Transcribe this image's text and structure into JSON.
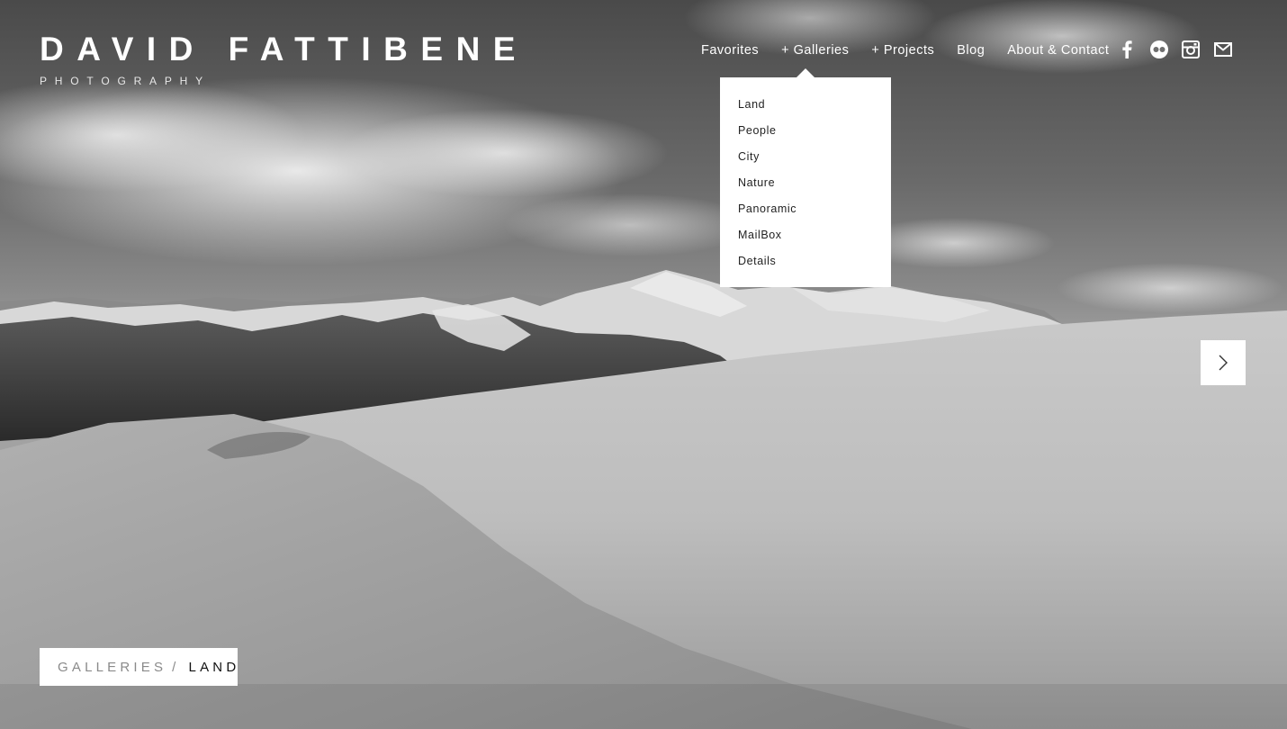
{
  "brand": {
    "name": "DAVID FATTIBENE",
    "tagline": "PHOTOGRAPHY"
  },
  "nav": {
    "items": [
      {
        "label": "Favorites"
      },
      {
        "label": "+ Galleries"
      },
      {
        "label": "+ Projects"
      },
      {
        "label": "Blog"
      },
      {
        "label": "About & Contact"
      }
    ],
    "social_icons": [
      "facebook-icon",
      "flickr-icon",
      "instagram-icon",
      "mail-icon"
    ]
  },
  "dropdown": {
    "items": [
      {
        "label": "Land"
      },
      {
        "label": "People"
      },
      {
        "label": "City"
      },
      {
        "label": "Nature"
      },
      {
        "label": "Panoramic"
      },
      {
        "label": "MailBox"
      },
      {
        "label": "Details"
      }
    ]
  },
  "slideshow": {
    "next_icon": "chevron-right-icon"
  },
  "breadcrumb": {
    "parent": "GALLERIES",
    "separator": "/",
    "current": "LAND"
  },
  "colors": {
    "text_light": "#ffffff",
    "panel": "#ffffff",
    "text_dark": "#111111",
    "muted": "#8a8a8a"
  }
}
